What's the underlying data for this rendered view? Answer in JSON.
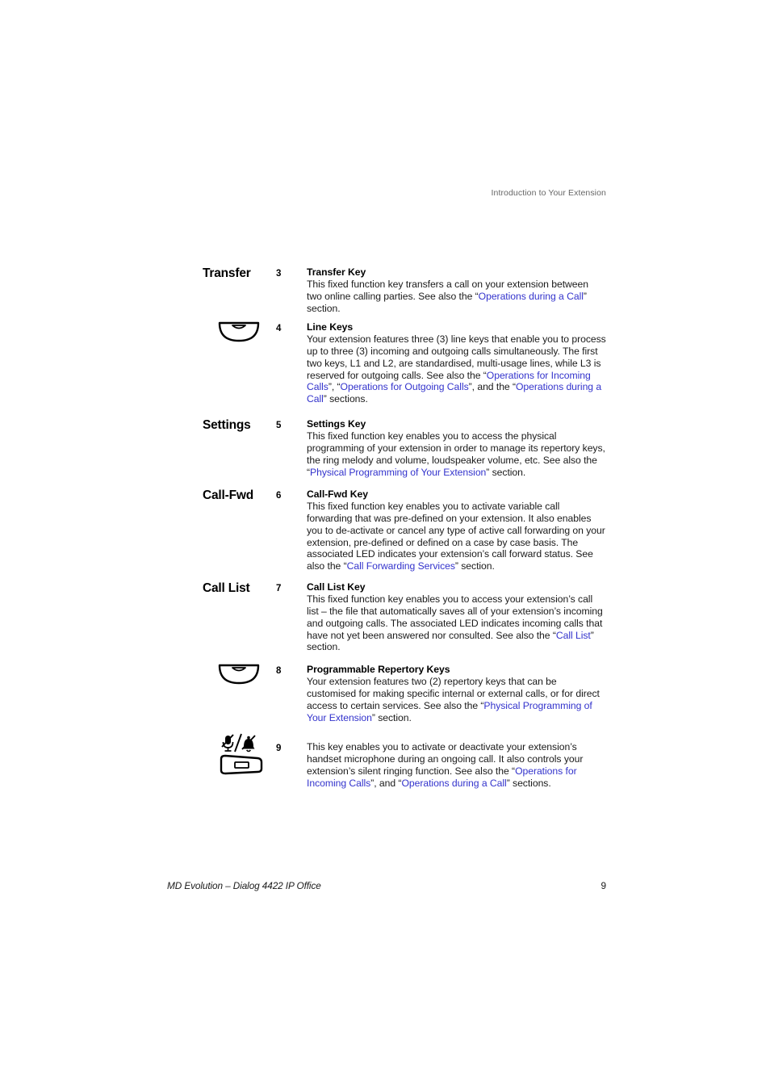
{
  "header": {
    "running_head": "Introduction to Your Extension"
  },
  "entries": [
    {
      "label": "Transfer",
      "icon": "none",
      "number": "3",
      "title": "Transfer Key",
      "text_parts": [
        {
          "t": "This fixed function key transfers a call on your extension between two online calling parties. See also the “",
          "link": false
        },
        {
          "t": "Operations during a Call",
          "link": true
        },
        {
          "t": "” section.",
          "link": false
        }
      ]
    },
    {
      "label": "",
      "icon": "line-key",
      "number": "4",
      "title": "Line Keys",
      "text_parts": [
        {
          "t": "Your extension features three (3) line keys that enable you to process up to three (3) incoming and outgoing calls simultaneously. The first two keys, L1 and L2, are standardised, multi-usage lines, while L3 is reserved for outgoing calls. See also the “",
          "link": false
        },
        {
          "t": "Operations for Incoming Calls",
          "link": true
        },
        {
          "t": "”, “",
          "link": false
        },
        {
          "t": "Operations for Outgoing Calls",
          "link": true
        },
        {
          "t": "”, and the “",
          "link": false
        },
        {
          "t": "Operations during a Call",
          "link": true
        },
        {
          "t": "” sections.",
          "link": false
        }
      ]
    },
    {
      "label": "Settings",
      "icon": "none",
      "number": "5",
      "title": "Settings Key",
      "text_parts": [
        {
          "t": "This fixed function key enables you to access the physical programming of your extension in order to manage its repertory keys, the ring melody and volume, loudspeaker volume, etc. See also the “",
          "link": false
        },
        {
          "t": "Physical Programming of Your Extension",
          "link": true
        },
        {
          "t": "” section.",
          "link": false
        }
      ]
    },
    {
      "label": "Call-Fwd",
      "icon": "none",
      "number": "6",
      "title": "Call-Fwd Key",
      "text_parts": [
        {
          "t": "This fixed function key enables you to activate variable call forwarding that was pre-defined on your extension. It also enables you to de-activate or cancel any type of active call forwarding on your extension, pre-defined or defined on a case by case basis. The associated LED indicates your extension’s call forward status. See also the “",
          "link": false
        },
        {
          "t": "Call Forwarding Services",
          "link": true
        },
        {
          "t": "” section.",
          "link": false
        }
      ]
    },
    {
      "label": "Call List",
      "icon": "none",
      "number": "7",
      "title": "Call List Key",
      "text_parts": [
        {
          "t": "This fixed function key enables you to access your extension’s call list – the file that automatically saves all of your extension’s incoming and outgoing calls. The associated LED indicates incoming calls that have not yet been answered nor consulted. See also the “",
          "link": false
        },
        {
          "t": "Call List",
          "link": true
        },
        {
          "t": "” section.",
          "link": false
        }
      ]
    },
    {
      "label": "",
      "icon": "line-key",
      "number": "8",
      "title": "Programmable Repertory Keys",
      "text_parts": [
        {
          "t": "Your extension features two (2) repertory keys that can be customised for making specific internal or external calls, or for direct access to certain services. See also the “",
          "link": false
        },
        {
          "t": "Physical Programming of Your Extension",
          "link": true
        },
        {
          "t": "” section.",
          "link": false
        }
      ]
    },
    {
      "label": "",
      "icon": "mute-silent-ring-key",
      "number": "9",
      "title": "",
      "text_parts": [
        {
          "t": "This key enables you to activate or deactivate your extension’s handset microphone during an ongoing call. It also controls your extension’s silent ringing function. See also the “",
          "link": false
        },
        {
          "t": "Operations for Incoming Calls",
          "link": true
        },
        {
          "t": "”, and “",
          "link": false
        },
        {
          "t": "Operations during a Call",
          "link": true
        },
        {
          "t": "” sections.",
          "link": false
        }
      ]
    }
  ],
  "footer": {
    "document_title": "MD Evolution – Dialog 4422 IP Office",
    "page_number": "9"
  },
  "colors": {
    "cross_reference": "#3333cc",
    "running_head": "#666666",
    "body_text": "#1a1a1a"
  }
}
